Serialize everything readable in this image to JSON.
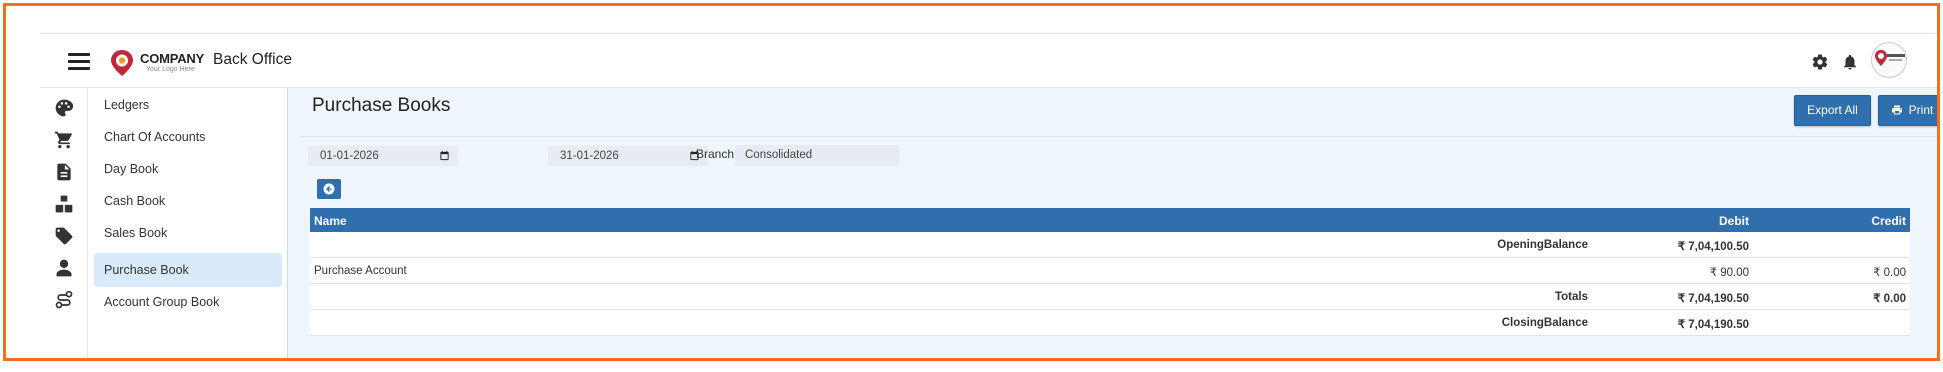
{
  "header": {
    "logo_name": "COMPANY",
    "logo_tagline": "Your Logo Here",
    "app_title": "Back Office"
  },
  "rail": {
    "icons": [
      "palette-icon",
      "cart-icon",
      "document-icon",
      "boxes-icon",
      "tag-icon",
      "user-icon",
      "route-icon"
    ]
  },
  "menu": {
    "items": [
      {
        "label": "Ledgers"
      },
      {
        "label": "Chart Of Accounts"
      },
      {
        "label": "Day Book"
      },
      {
        "label": "Cash Book"
      },
      {
        "label": "Sales Book"
      },
      {
        "label": "Purchase Book",
        "active": true
      },
      {
        "label": "Account Group Book"
      }
    ]
  },
  "main": {
    "page_title": "Purchase Books",
    "export_label": "Export All",
    "print_label": "Print",
    "from_date": "01-01-2026",
    "to_date": "31-01-2026",
    "branch_label": "Branch",
    "branch_value": "Consolidated"
  },
  "table": {
    "headers": {
      "name": "Name",
      "debit": "Debit",
      "credit": "Credit"
    },
    "opening": {
      "label": "OpeningBalance",
      "debit": "₹ 7,04,100.50",
      "credit": ""
    },
    "rows": [
      {
        "name": "Purchase Account",
        "debit": "₹ 90.00",
        "credit": "₹ 0.00"
      }
    ],
    "totals": {
      "label": "Totals",
      "debit": "₹ 7,04,190.50",
      "credit": "₹ 0.00"
    },
    "closing": {
      "label": "ClosingBalance",
      "debit": "₹ 7,04,190.50",
      "credit": ""
    }
  },
  "colors": {
    "primary": "#2f6fae",
    "frame": "#f07020",
    "active_menu": "#d9eafb",
    "main_bg": "#eef5fc"
  }
}
